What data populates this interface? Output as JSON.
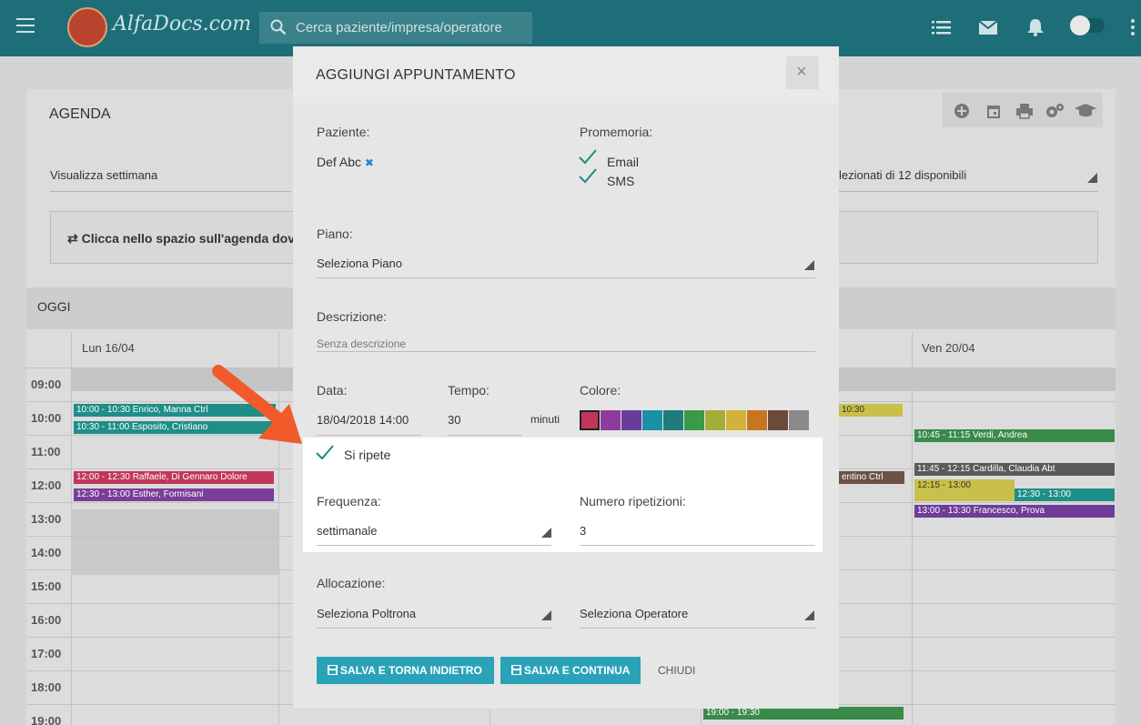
{
  "topbar": {
    "logo_text": "AlfaDocs.com",
    "search_placeholder": "Cerca paziente/impresa/operatore",
    "icons": [
      "menu-icon",
      "list-icon",
      "mail-icon",
      "bell-icon",
      "toggle-switch",
      "more-icon"
    ]
  },
  "agenda": {
    "title": "AGENDA",
    "week_select": "Visualizza settimana",
    "selected_available": "lezionati di 12 disponibili",
    "hint": "Clicca nello spazio sull'agenda dov",
    "today": "OGGI",
    "days": [
      "Lun 16/04",
      "Ven 20/04"
    ],
    "hours": [
      "09:00",
      "10:00",
      "11:00",
      "12:00",
      "13:00",
      "14:00",
      "15:00",
      "16:00",
      "17:00",
      "18:00",
      "19:00"
    ],
    "appointments": [
      {
        "text": "10:00 - 10:30 Enrico, Manna",
        "tag": "Ctrl",
        "color": "#1e8f87"
      },
      {
        "text": "10:30 - 11:00 Esposito, Cristiano",
        "tag": "",
        "color": "#1e8f87"
      },
      {
        "text": "12:00 - 12:30 Raffaele, Di Gennaro",
        "tag": "Dolore",
        "color": "#c0375a"
      },
      {
        "text": "12:30 - 13:00 Esther, Formisani",
        "tag": "",
        "color": "#7d3c98"
      },
      {
        "text": "10:30",
        "tag": "",
        "color": "#c8c04a"
      },
      {
        "text": "entino",
        "tag": "Ctrl",
        "color": "#6b5246"
      },
      {
        "text": "10:45 - 11:15 Verdi, Andrea",
        "tag": "",
        "color": "#3a8a4a"
      },
      {
        "text": "11:45 - 12:15 Cardilla, Claudia",
        "tag": "Abt",
        "color": "#5a5a5a"
      },
      {
        "text": "12:15 - 13:00",
        "tag": "",
        "color": "#c8c04a"
      },
      {
        "text": "12:30 - 13:00",
        "tag": "",
        "color": "#1e8f87"
      },
      {
        "text": "13:00 - 13:30 Francesco, Prova",
        "tag": "",
        "color": "#6f3c98"
      },
      {
        "text": "19:00 - 19:30",
        "tag": "",
        "color": "#3a8a4a"
      }
    ]
  },
  "modal": {
    "title": "AGGIUNGI APPUNTAMENTO",
    "close_label": "×",
    "patient_label": "Paziente:",
    "patient_value": "Def Abc",
    "patient_remove": "✖",
    "reminder_label": "Promemoria:",
    "reminder_email": "Email",
    "reminder_sms": "SMS",
    "plan_label": "Piano:",
    "plan_value": "Seleziona Piano",
    "description_label": "Descrizione:",
    "description_placeholder": "Senza descrizione",
    "date_label": "Data:",
    "date_value": "18/04/2018 14:00",
    "time_label": "Tempo:",
    "time_value": "30",
    "time_unit": "minuti",
    "color_label": "Colore:",
    "colors": [
      "#c0375a",
      "#8e3a9e",
      "#6a3c9a",
      "#1b8fa6",
      "#1e7d7a",
      "#3a9a48",
      "#a4ad36",
      "#d2b23a",
      "#c8761e",
      "#6b4a3a",
      "#8a8a8a"
    ],
    "repeat_label": "Si ripete",
    "frequency_label": "Frequenza:",
    "frequency_value": "settimanale",
    "repetitions_label": "Numero ripetizioni:",
    "repetitions_value": "3",
    "allocation_label": "Allocazione:",
    "chair_value": "Seleziona Poltrona",
    "operator_value": "Seleziona Operatore",
    "save_back_label": "SALVA E TORNA INDIETRO",
    "save_continue_label": "SALVA E CONTINUA",
    "close_text": "CHIUDI"
  }
}
